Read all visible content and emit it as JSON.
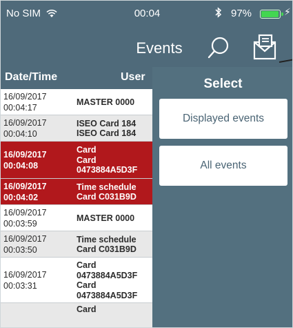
{
  "status_bar": {
    "carrier": "No SIM",
    "time": "00:04",
    "battery_percent": "97%",
    "battery_level": 0.97,
    "wifi_icon": "wifi-icon",
    "bluetooth_icon": "bluetooth-icon"
  },
  "nav": {
    "title": "Events",
    "search_icon": "search-icon",
    "mail_icon": "mail-icon"
  },
  "table": {
    "columns": [
      "Date/Time",
      "User"
    ],
    "rows": [
      {
        "date": "16/09/2017",
        "time": "00:04:17",
        "user": [
          "MASTER 0000"
        ],
        "style": "light"
      },
      {
        "date": "16/09/2017",
        "time": "00:04:10",
        "user": [
          "ISEO Card 184",
          "ISEO Card 184"
        ],
        "style": "grey"
      },
      {
        "date": "16/09/2017",
        "time": "00:04:08",
        "user": [
          "Card",
          "Card",
          "0473884A5D3F"
        ],
        "style": "red"
      },
      {
        "date": "16/09/2017",
        "time": "00:04:02",
        "user": [
          "Time schedule",
          "Card C031B9D"
        ],
        "style": "red"
      },
      {
        "date": "16/09/2017",
        "time": "00:03:59",
        "user": [
          "MASTER 0000"
        ],
        "style": "light"
      },
      {
        "date": "16/09/2017",
        "time": "00:03:50",
        "user": [
          "Time schedule",
          "Card C031B9D"
        ],
        "style": "grey"
      },
      {
        "date": "16/09/2017",
        "time": "00:03:31",
        "user": [
          "Card",
          "0473884A5D3F",
          "Card",
          "0473884A5D3F"
        ],
        "style": "light"
      },
      {
        "date": "",
        "time": "",
        "user": [
          "Card"
        ],
        "style": "grey"
      }
    ]
  },
  "select_panel": {
    "title": "Select",
    "options": [
      "Displayed events",
      "All events"
    ]
  },
  "colors": {
    "background": "#4f6a7a",
    "alert_row": "#b1181c",
    "battery": "#43d651"
  }
}
